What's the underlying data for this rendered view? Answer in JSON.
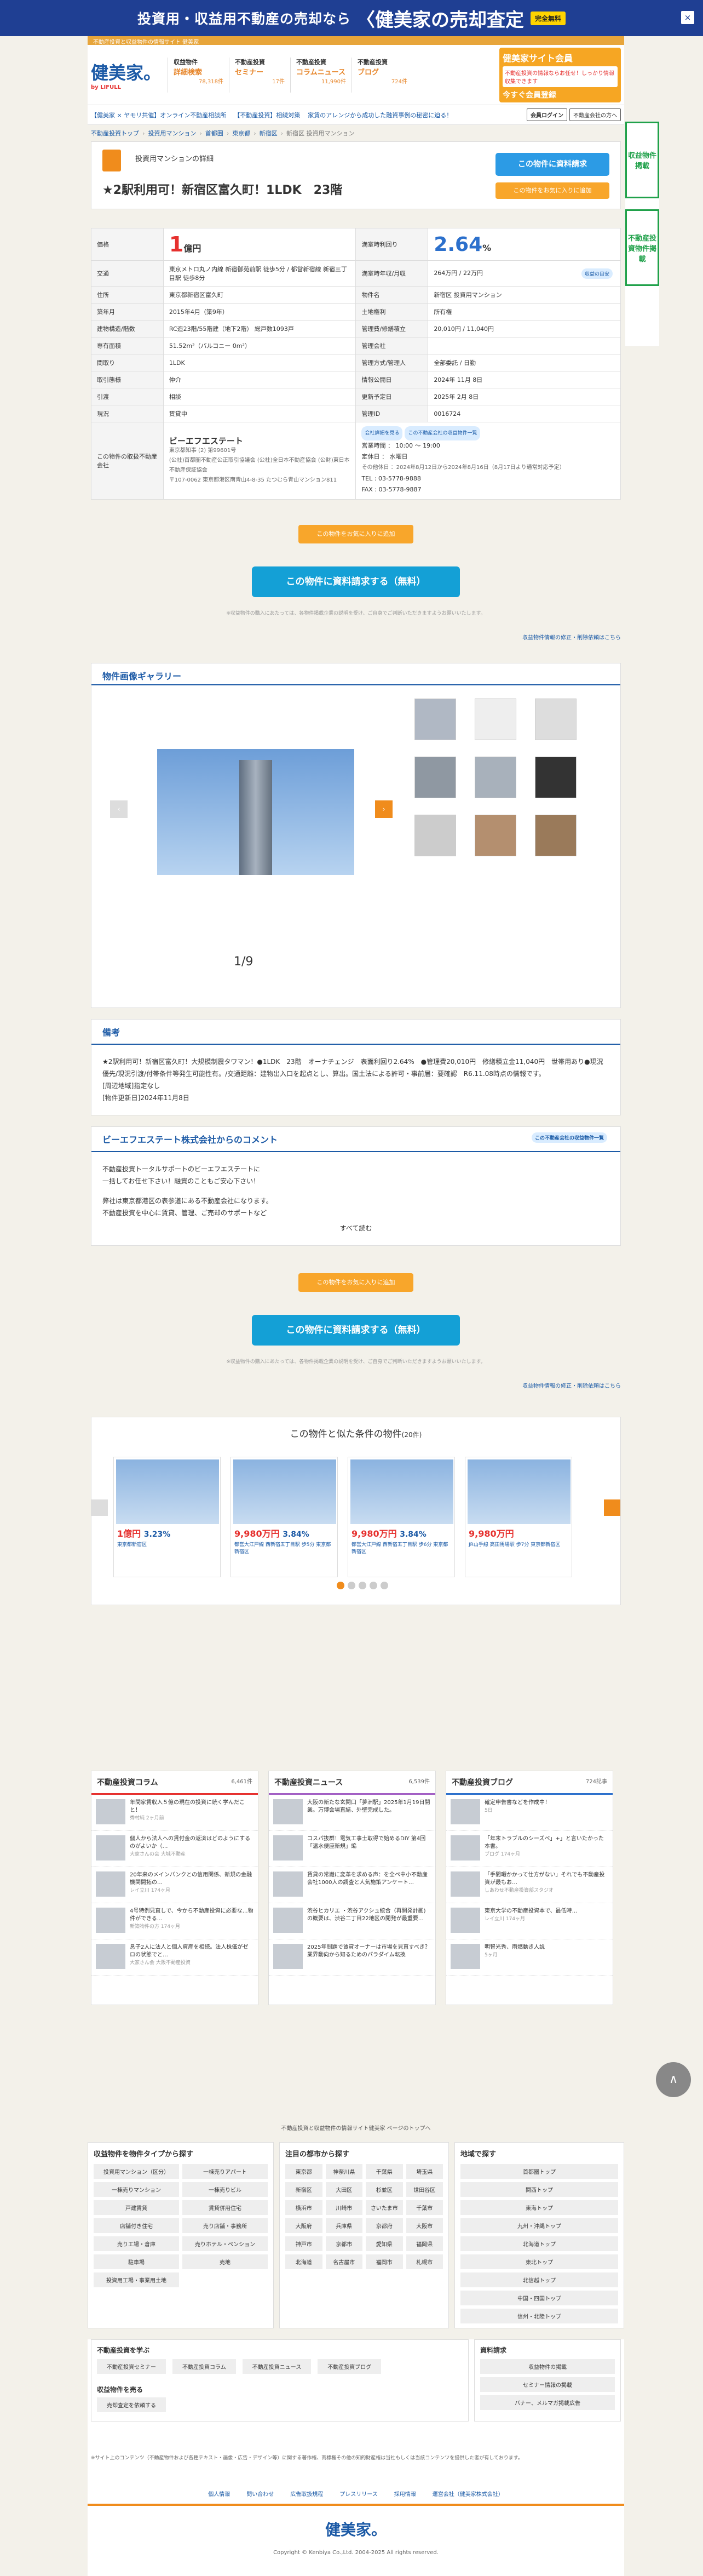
{
  "topbanner": {
    "text": "投資用・収益用不動産の売却なら",
    "brand": "〈健美家の売却査定",
    "badge": "完全無料"
  },
  "meta_row": "不動産投資と収益物件の情報サイト 健美家",
  "header": {
    "logo": "健美家。",
    "logo_sub": "by LIFULL",
    "stats": [
      {
        "title": "収益物件",
        "sub": "詳細検索",
        "count": "78,318件"
      },
      {
        "title": "不動産投資",
        "sub": "セミナー",
        "count": "17件"
      },
      {
        "title": "不動産投資",
        "sub": "コラムニュース",
        "count": "11,990件"
      },
      {
        "title": "不動産投資",
        "sub": "ブログ",
        "count": "724件"
      }
    ],
    "member": {
      "title": "健美家サイト会員",
      "body": "不動産投資の情報ならお任せ！しっかり情報収集できます",
      "cta": "今すぐ会員登録"
    }
  },
  "navbar": {
    "links": [
      "【健美家 × ヤモリ共催】オンライン不動産相談所",
      "【不動産投資】相続対策",
      "家賃のアレンジから成功した融資事例の秘密に迫る！"
    ],
    "login": "会員ログイン",
    "register": "不動産会社の方へ"
  },
  "breadcrumb": [
    "不動産投資トップ",
    "投資用マンション",
    "首都圏",
    "東京都",
    "新宿区",
    "新宿区 投資用マンション"
  ],
  "title": {
    "kind": "投資用マンションの詳細",
    "name": "★2駅利用可！新宿区富久町！1LDK　23階",
    "request_button": "この物件に資料請求",
    "fav_button": "この物件をお気に入りに追加"
  },
  "specs": {
    "price_label": "価格",
    "price_num": "1",
    "price_unit": "億円",
    "yield_label": "満室時利回り",
    "yield_num": "2.64",
    "yield_unit": "%",
    "rows": [
      [
        "交通",
        "東京メトロ丸ノ内線 新宿御苑前駅 徒歩5分 / 都営新宿線 新宿三丁目駅 徒歩8分",
        "満室時年収/月収",
        "264万円 / 22万円"
      ],
      [
        "住所",
        "東京都新宿区富久町",
        "物件名",
        "新宿区 投資用マンション"
      ],
      [
        "築年月",
        "2015年4月（築9年）",
        "土地権利",
        "所有権"
      ],
      [
        "建物構造/階数",
        "RC造23階/55階建（地下2階） 総戸数1093戸",
        "管理費/修繕積立",
        "20,010円 / 11,040円"
      ],
      [
        "専有面積",
        "51.52m²（バルコニー 0m²）",
        "管理会社",
        ""
      ],
      [
        "間取り",
        "1LDK",
        "管理方式/管理人",
        "全部委託 / 日勤"
      ],
      [
        "取引態様",
        "仲介",
        "情報公開日",
        "2024年 11月 8日"
      ],
      [
        "引渡",
        "相談",
        "更新予定日",
        "2025年 2月 8日"
      ],
      [
        "現況",
        "賃貸中",
        "管理ID",
        "0016724"
      ]
    ],
    "simulate": "収益の目安",
    "company_label": "この物件の取扱不動産会社",
    "company_name": "ビーエフエステート",
    "company_license": "東京都知事 (2) 第99601号",
    "company_assoc": "(公社)首都圏不動産公正取引協議会 (公社)全日本不動産協会 (公財)東日本不動産保証協会",
    "company_addr": "〒107-0062 東京都港区南青山4-8-35 たつむら青山マンション811",
    "tag1": "会社詳細を見る",
    "tag2": "この不動産会社の収益物件一覧",
    "hours": "営業時間 ： 10:00 ～ 19:00",
    "closed": "定休日 ： 水曜日",
    "other_closed": "その他休日 ：2024年8月12日から2024年8月16日（8月17日より通常対応予定）",
    "tel": "TEL : 03-5778-9888",
    "fax": "FAX : 03-5778-9887"
  },
  "actions": {
    "fav2": "この物件をお気に入りに追加",
    "bigreq": "この物件に資料請求する（無料）",
    "note": "※収益物件の購入にあたっては、各物件掲載企業の説明を受け、ご自身でご判断いただきますようお願いいたします。",
    "report": "収益物件情報の修正・削除依頼はこちら"
  },
  "gallery": {
    "title": "物件画像ギャラリー",
    "counter": "1/9",
    "prev": "‹",
    "next": "›"
  },
  "remarks": {
    "title": "備考",
    "body": "★2駅利用可！新宿区富久町！大規模制震タワマン！●1LDK　23階　オーナチェンジ　表面利回り2.64%　●管理費20,010円　修繕積立金11,040円　世帯用あり●現況優先/現況引渡/付帯条件等発生可能性有。/交通距離：建物出入口を起点とし、算出。国土法による許可・事前届：要確認　R6.11.08時点の情報です。",
    "ext1": "[周辺地域]指定なし",
    "ext2": "[物件更新日]2024年11月8日"
  },
  "comment": {
    "title": "ビーエフエステート株式会社からのコメント",
    "tag": "この不動産会社の収益物件一覧",
    "line1": "不動産投資トータルサポートのビーエフエステートに",
    "line2": "一括してお任せ下さい！融資のこともご安心下さい！",
    "line3": "弊社は東京都港区の表参道にある不動産会社になります。",
    "line4": "不動産投資を中心に賃貸、管理、ご売却のサポートなど",
    "more": "すべて読む"
  },
  "similar": {
    "title": "この物件と似た条件の物件",
    "count": "(20件)",
    "cards": [
      {
        "price": "1億円",
        "yield": "3.23%",
        "addr": "東京都新宿区"
      },
      {
        "price": "9,980万円",
        "yield": "3.84%",
        "addr": "都営大江戸線 西新宿五丁目駅 歩5分 東京都新宿区"
      },
      {
        "price": "9,980万円",
        "yield": "3.84%",
        "addr": "都営大江戸線 西新宿五丁目駅 歩6分 東京都新宿区"
      },
      {
        "price": "9,980万円",
        "yield": "",
        "addr": "JR山手線 高田馬場駅 歩7分 東京都新宿区"
      }
    ]
  },
  "columns": {
    "col": {
      "title": "不動産投資コラム",
      "count": "6,461件",
      "items": [
        [
          "年間家賃収入５億の現在の投資に続く学んだこと！",
          "秀村純 2ヶ月前"
        ],
        [
          "個人から法人への賃付金の返済はどのようにするのがよいか（…",
          "大家さんの会 大城不動産"
        ],
        [
          "20年来のメインバンクとの信用関係、新規の金融機関開拓の…",
          "レイ立川 174ヶ月"
        ],
        [
          "4号特例見直しで、今から不動産投資に必要な…物件ができる…",
          "新築物件の方 174ヶ月"
        ],
        [
          "息子2人に法人と個人資産を相続。法人株価がゼロの状態でと…",
          "大家さん会 大阪不動産投資"
        ]
      ]
    },
    "news": {
      "title": "不動産投資ニュース",
      "count": "6,539件",
      "items": [
        [
          "大阪の新たな玄関口「夢洲駅」2025年1月19日開業。万博会場直結、外壁完成した。",
          ""
        ],
        [
          "コスパ抜群！電気工事士取得で始めるDIY 第4回「温水便座新規」編",
          ""
        ],
        [
          "賃貸の常識に変革を求める声：を全ペ中小不動産会社1000人の調査と人気施策アンケート…",
          ""
        ],
        [
          "渋谷ヒカリエ ・渋谷アクシュ統合（再開発計画)の概要は、渋谷二丁目22地区の開発が最重要…",
          ""
        ],
        [
          "2025年問題で賃貸オーナーは市場を見直すべき？業界動向から知るためのパラダイム転換",
          ""
        ]
      ]
    },
    "blog": {
      "title": "不動産投資ブログ",
      "count": "724記事",
      "items": [
        [
          "確定申告書などを作成中！",
          "5日"
        ],
        [
          "「年末トラブルのシーズべ」+」と言いたかった本書。",
          "ブログ 174ヶ月"
        ],
        [
          "「手間暇かかって仕方がない」それでも不動産投資が最もお…",
          "しあわせ不動産投資部スタジオ"
        ],
        [
          "東京大学の不動産投資本で、最低時…",
          "レイ立川 174ヶ月"
        ],
        [
          "明智光秀、雨燃動き人説",
          "5ヶ月"
        ]
      ]
    }
  },
  "backtop": "∧",
  "foot": {
    "toplink": "不動産投資と収益物件の情報サイト健美家 ページのトップへ",
    "type_title": "収益物件を物件タイプから探す",
    "types": [
      "投資用マンション（区分）",
      "一棟売りアパート",
      "一棟売りマンション",
      "一棟売りビル",
      "戸建賃貸",
      "賃貸併用住宅",
      "店舗付き住宅",
      "売り店舗・事務所",
      "売り工場・倉庫",
      "売りホテル・ペンション",
      "駐車場",
      "売地",
      "投資用工場・事業用土地"
    ],
    "city_title": "注目の都市から探す",
    "cities": [
      "東京都",
      "神奈川県",
      "千葉県",
      "埼玉県",
      "新宿区",
      "大田区",
      "杉並区",
      "世田谷区",
      "横浜市",
      "川崎市",
      "さいたま市",
      "千葉市",
      "大阪府",
      "兵庫県",
      "京都府",
      "大阪市",
      "神戸市",
      "京都市",
      "愛知県",
      "福岡県",
      "北海道",
      "名古屋市",
      "福岡市",
      "札幌市"
    ],
    "area_title": "地域で探す",
    "areas": [
      "首都圏トップ",
      "関西トップ",
      "東海トップ",
      "九州・沖縄トップ",
      "北海道トップ",
      "東北トップ",
      "北信越トップ",
      "中国・四国トップ",
      "信州・北陸トップ"
    ],
    "learn_title": "不動産投資を学ぶ",
    "learn": [
      "不動産投資セミナー",
      "不動産投資コラム",
      "不動産投資ニュース",
      "不動産投資ブログ"
    ],
    "sell_title": "収益物件を売る",
    "sell": "売却査定を依頼する",
    "material_title": "資料請求",
    "materials": [
      "収益物件の掲載",
      "セミナー情報の掲載",
      "バナー、メルマガ掲載広告"
    ],
    "copy_note": "※サイト上のコンテンツ（不動産物件および各種テキスト・画像・広告・デザイン等）に関する著作権、商標権その他の知的財産権は当社もしくは当該コンテンツを提供した者が有しております。",
    "bottom_links": [
      "個人情報",
      "問い合わせ",
      "広告取扱規程",
      "プレスリリース",
      "採用情報",
      "運営会社（健美家株式会社）"
    ],
    "logo": "健美家。",
    "copyright": "Copyright © Kenbiya Co.,Ltd. 2004-2025 All rights reserved."
  },
  "sidead": {
    "ad1": "収益物件掲載",
    "ad2": "不動産投資物件掲載"
  }
}
